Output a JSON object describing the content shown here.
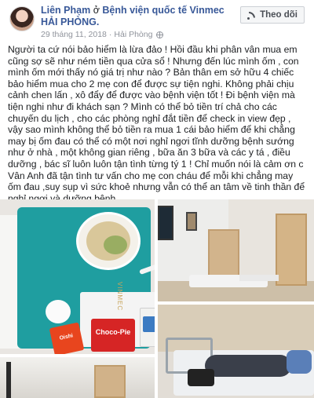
{
  "post": {
    "author": "Liên Phạm",
    "connector": " ở ",
    "location": "Bệnh viện quốc tế Vinmec HẢI PHÒNG.",
    "date": "29 tháng 11, 2018",
    "separator": " · ",
    "city": "Hải Phòng",
    "privacy_icon": "globe-icon",
    "body": "Người ta cứ nói bảo hiểm là lừa đảo ! Hồi đầu khi phân vân mua em cũng sợ sẽ như ném tiền qua cửa sổ ! Nhưng đến lúc mình ốm , con mình ốm mới thấy nó giá trị như nào ? Bản thân em sở hữu 4 chiếc bảo hiểm mua cho 2 mẹ con để được sự tiện nghi. Không phải chịu cảnh chen lấn , xô đẩy để được vào bệnh viện tốt ! Đi bệnh viện mà tiện nghi như đi khách sạn ? Mình có thể bỏ tiền trí chả cho các chuyến du lịch , cho các phòng nghỉ đắt tiền để check in view đẹp , vậy sao mình không thể bỏ tiền ra mua 1 cái bảo hiểm để khi chẳng may bị ốm đau có thể có một nơi nghỉ ngơi tĩnh dưỡng bệnh sướng như ở nhà , một không gian riêng , bữa ăn 3 bữa và các y tá , điều dưỡng , bác sĩ luôn luôn tận tình từng tý 1 ! Chỉ muốn nói là cảm ơn c Vân Anh đã tận tình tư vấn cho mẹ con cháu để mỗi khi chẳng may ốm đau ,suy sụp vì sức khoẻ nhưng vẫn có thể an tâm về tinh thần để nghỉ ngơi và dưỡng bệnh ."
  },
  "follow_button": {
    "label": "Theo dõi",
    "icon": "rss-icon"
  },
  "photos": {
    "tray_brand": "VINMEC",
    "snack_1": "Oishi",
    "snack_2": "Choco-Pie"
  },
  "colors": {
    "link": "#385898",
    "meta": "#90949c",
    "tray": "#1f9ea0"
  }
}
